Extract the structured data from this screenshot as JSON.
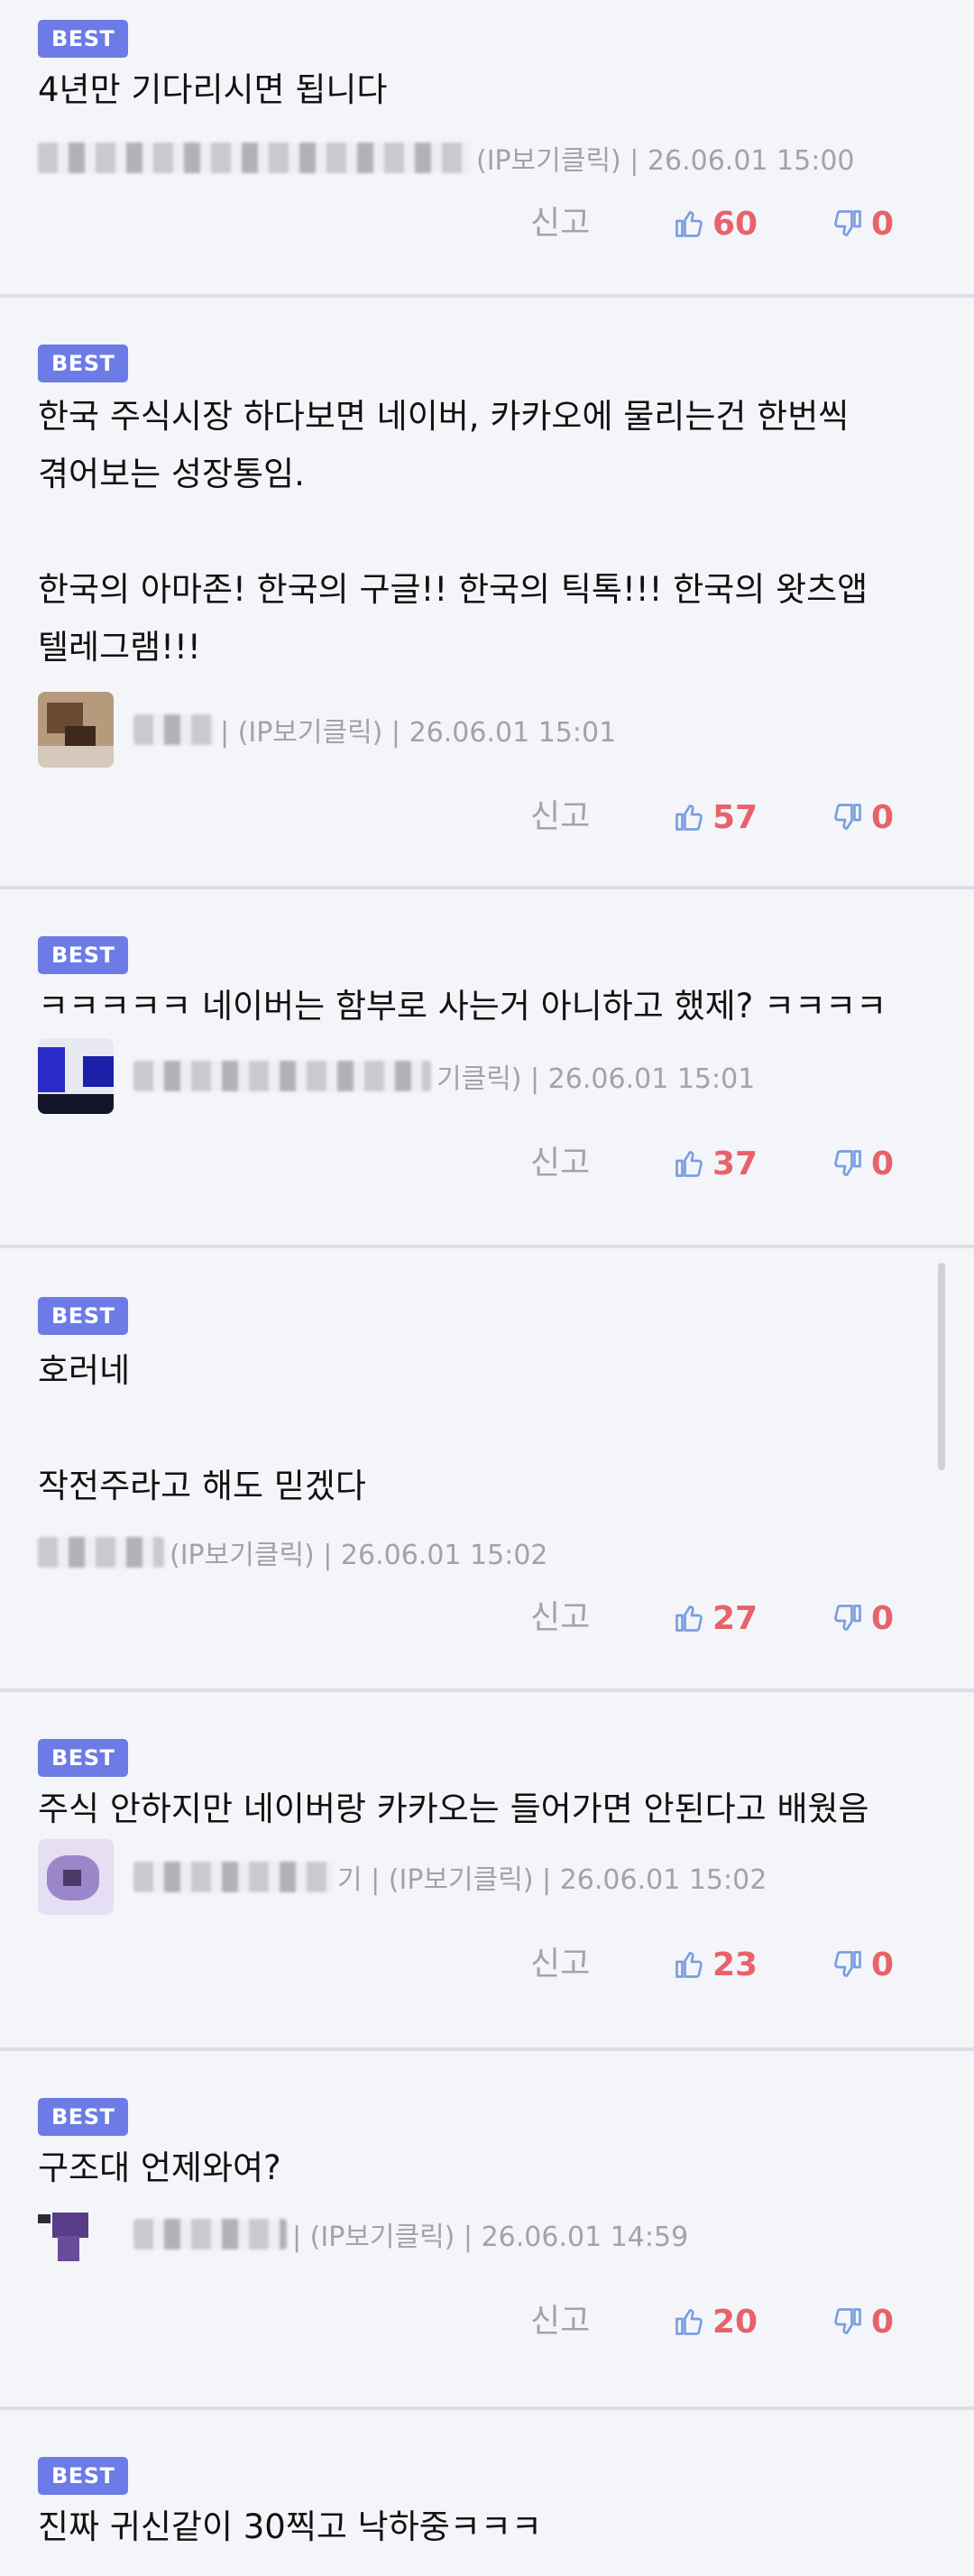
{
  "badge": "BEST",
  "report_label": "신고",
  "comments": [
    {
      "body": "4년만 기다리시면 됩니다",
      "nick_tail": "(IP보기클릭) | 26.06.01 15:00",
      "likes": "60",
      "dislikes": "0"
    },
    {
      "body": "한국 주식시장 하다보면 네이버, 카카오에 물리는건 한번씩\n겪어보는 성장통임.\n\n한국의 아마존! 한국의 구글!! 한국의 틱톡!!! 한국의 왓츠앱\n텔레그램!!!",
      "nick_tail": "| (IP보기클릭) | 26.06.01 15:01",
      "likes": "57",
      "dislikes": "0"
    },
    {
      "body": "ㅋㅋㅋㅋㅋ 네이버는 함부로 사는거 아니하고 했제? ㅋㅋㅋㅋ",
      "nick_tail": "기클릭) | 26.06.01 15:01",
      "likes": "37",
      "dislikes": "0"
    },
    {
      "body": "호러네\n\n작전주라고 해도 믿겠다",
      "nick_tail": "(IP보기클릭) | 26.06.01 15:02",
      "likes": "27",
      "dislikes": "0"
    },
    {
      "body": "주식 안하지만 네이버랑 카카오는 들어가면 안된다고 배웠음",
      "nick_tail": "기 | (IP보기클릭) | 26.06.01 15:02",
      "likes": "23",
      "dislikes": "0"
    },
    {
      "body": "구조대 언제와여?",
      "nick_tail": "| (IP보기클릭) | 26.06.01 14:59",
      "likes": "20",
      "dislikes": "0"
    },
    {
      "body": "진짜 귀신같이 30찍고 낙하중ㅋㅋㅋ",
      "nick_tail": "",
      "likes": "",
      "dislikes": ""
    }
  ],
  "colors": {
    "badge": "#6c7be6",
    "count": "#e7626a",
    "icon": "#7b9ee0",
    "background": "#f4f5f9"
  }
}
